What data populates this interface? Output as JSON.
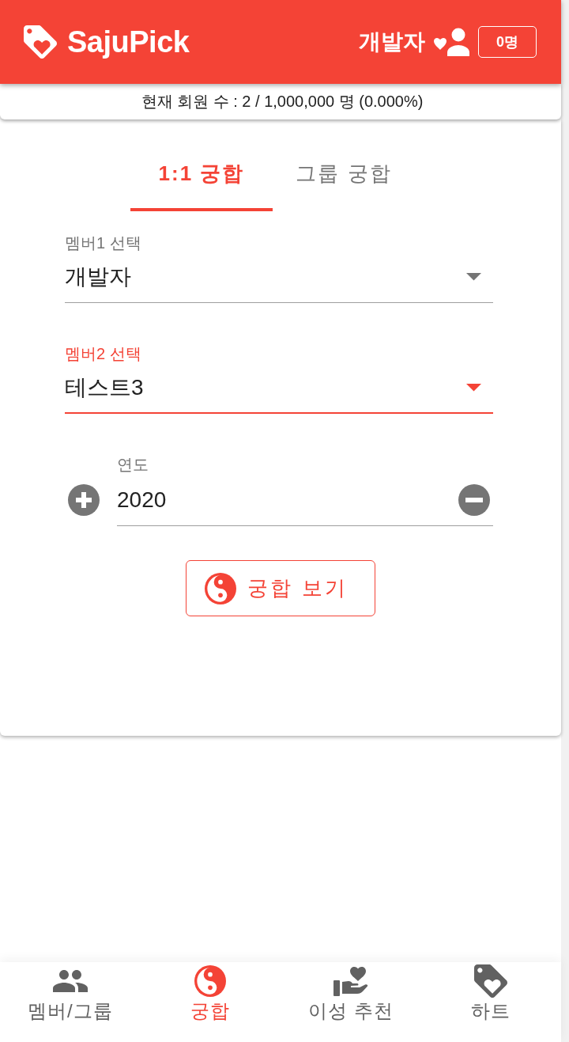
{
  "header": {
    "logo_text": "SajuPick",
    "user_name": "개발자",
    "member_badge": "0명"
  },
  "member_count": {
    "text": "현재 회원 수 : 2 / 1,000,000 명 (0.000%)"
  },
  "tabs": [
    {
      "label": "1:1 궁합",
      "selected": true
    },
    {
      "label": "그룹 궁합",
      "selected": false
    }
  ],
  "fields": [
    {
      "kind": "select",
      "label": "멤버1 선택",
      "value": "개발자",
      "focused": false
    },
    {
      "kind": "select",
      "label": "멤버2 선택",
      "value": "테스트3",
      "focused": true
    },
    {
      "kind": "stepper",
      "label": "연도",
      "value": "2020",
      "focused": false
    }
  ],
  "action_button": {
    "label": "궁합 보기"
  },
  "bottom_nav": [
    {
      "label": "멤버/그룹",
      "selected": false
    },
    {
      "label": "궁합",
      "selected": true
    },
    {
      "label": "이성 추천",
      "selected": false
    },
    {
      "label": "하트",
      "selected": false
    }
  ]
}
